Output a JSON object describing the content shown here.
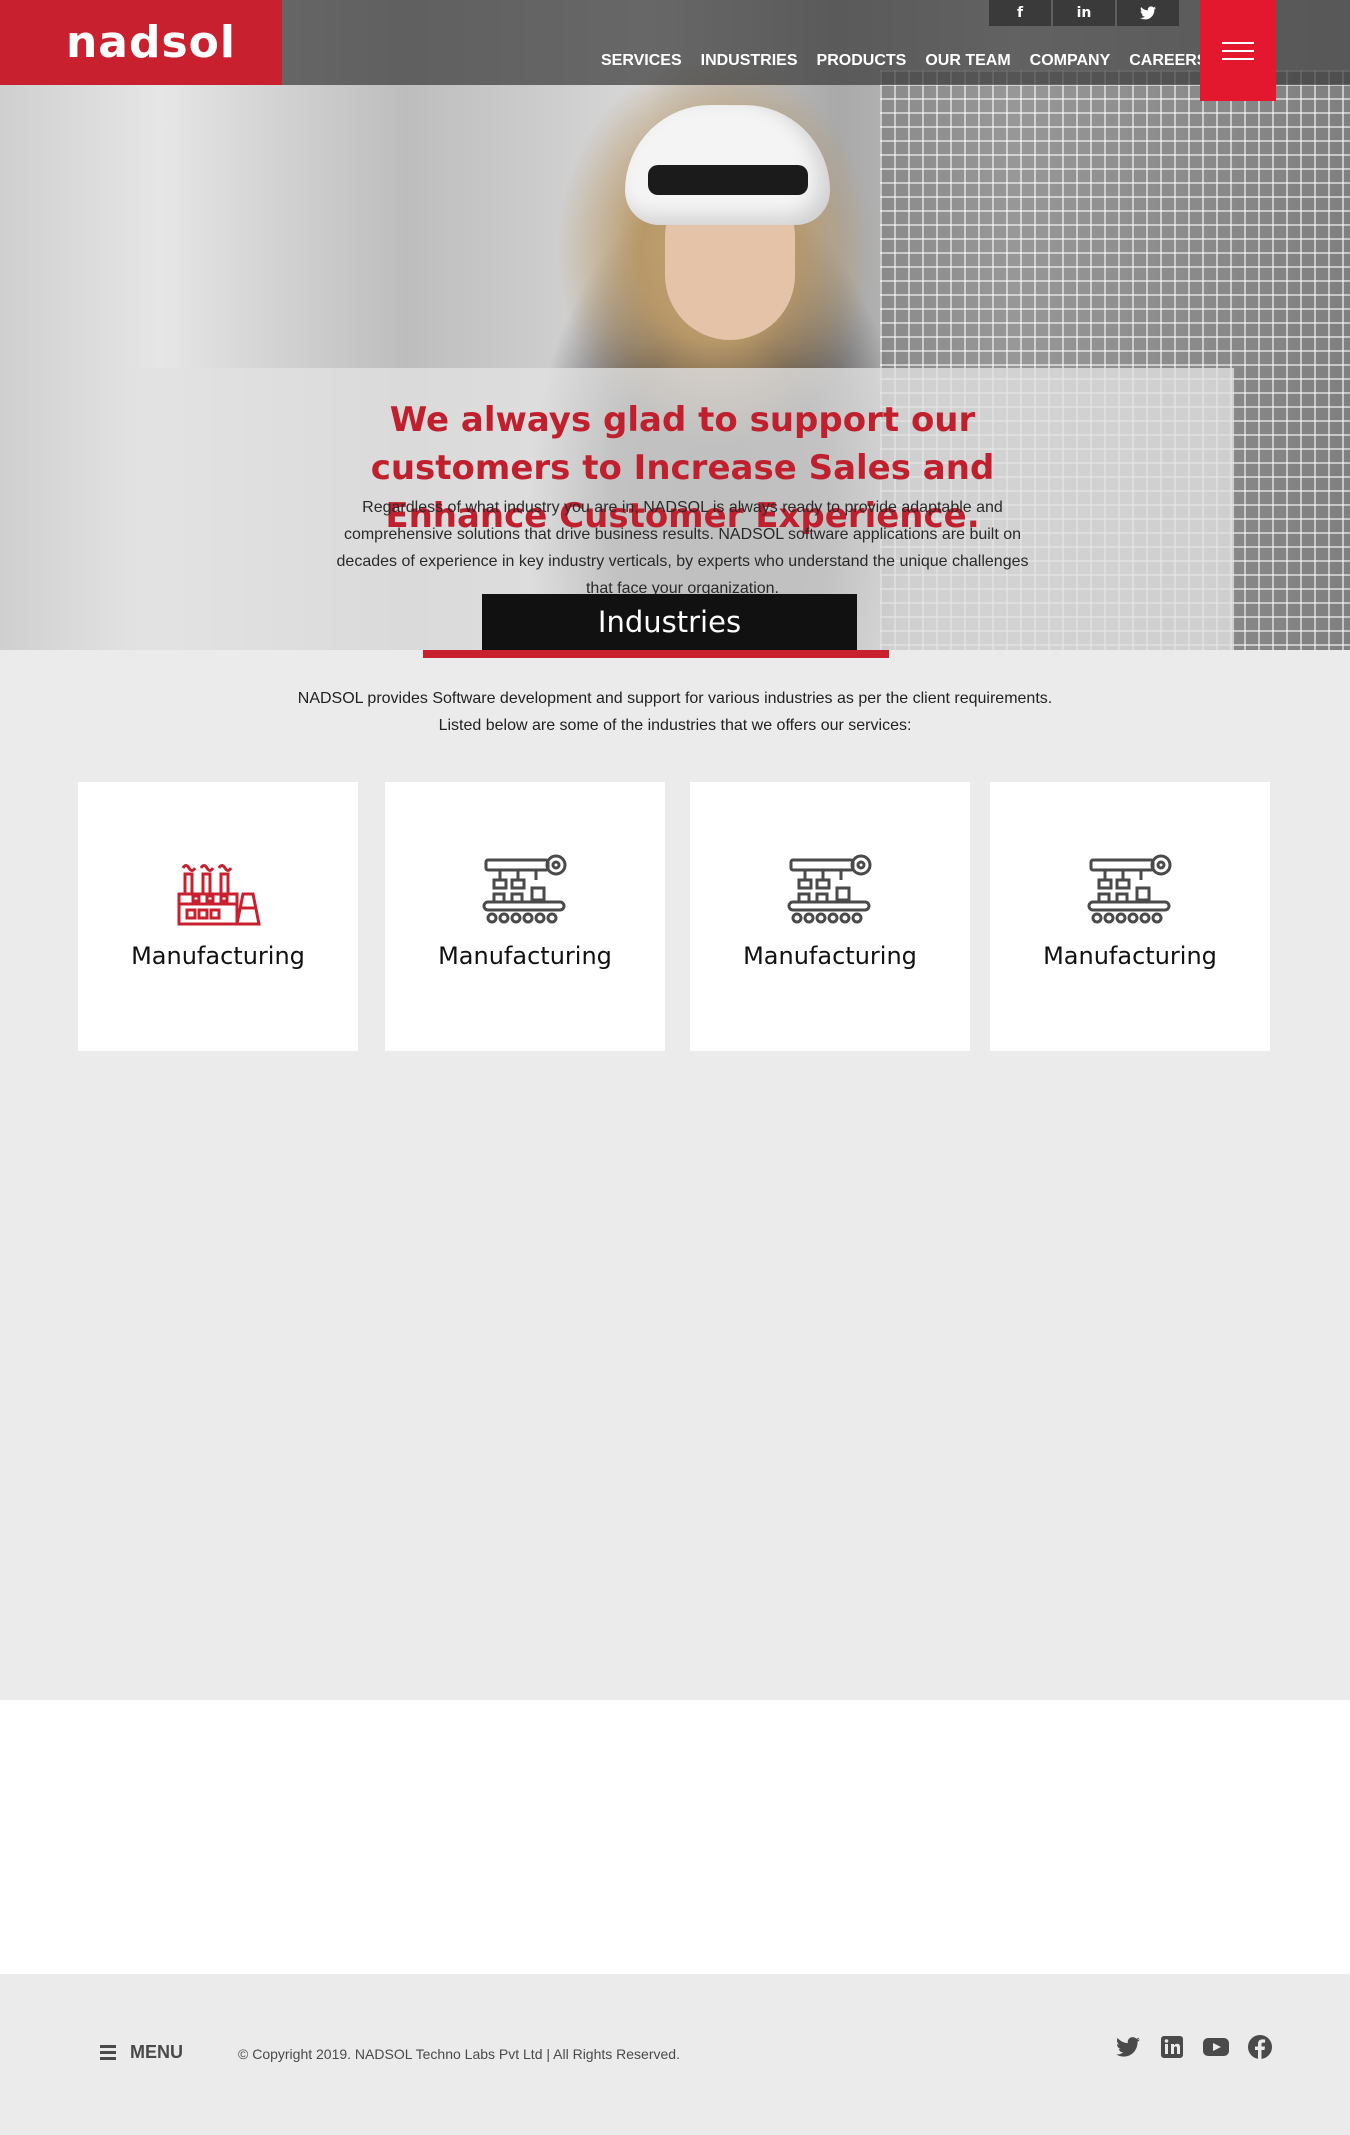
{
  "brand": {
    "logo": "nadsol"
  },
  "social_top": [
    "f",
    "in",
    "twitter"
  ],
  "nav": {
    "items": [
      "SERVICES",
      "INDUSTRIES",
      "PRODUCTS",
      "OUR TEAM",
      "COMPANY",
      "CAREERS"
    ]
  },
  "hero": {
    "title": "We always glad to support our customers to Increase Sales and Enhance Customer Experience.",
    "description": "Regardless of what industry you are in, NADSOL is always ready to provide adaptable and comprehensive solutions that drive business results. NADSOL software applications are built on decades of experience in key industry verticals, by experts who understand the unique challenges that face your organization.",
    "tab_label": "Industries"
  },
  "intro": {
    "line1": "NADSOL provides Software development and support for various industries as per the client requirements.",
    "line2": "Listed below are some of the industries that we offers our services:"
  },
  "cards": [
    {
      "label": "Manufacturing",
      "icon": "factory-icon"
    },
    {
      "label": "Manufacturing",
      "icon": "assembly-line-icon"
    },
    {
      "label": "Manufacturing",
      "icon": "assembly-line-icon"
    },
    {
      "label": "Manufacturing",
      "icon": "assembly-line-icon"
    }
  ],
  "footer": {
    "menu_label": "MENU",
    "copyright": "© Copyright 2019. NADSOL Techno Labs Pvt Ltd  |  All Rights Reserved.",
    "social": [
      "twitter-icon",
      "linkedin-icon",
      "youtube-icon",
      "facebook-icon"
    ]
  },
  "colors": {
    "brand_red": "#c8202f",
    "menu_red": "#e3182e",
    "dark": "#111111"
  }
}
